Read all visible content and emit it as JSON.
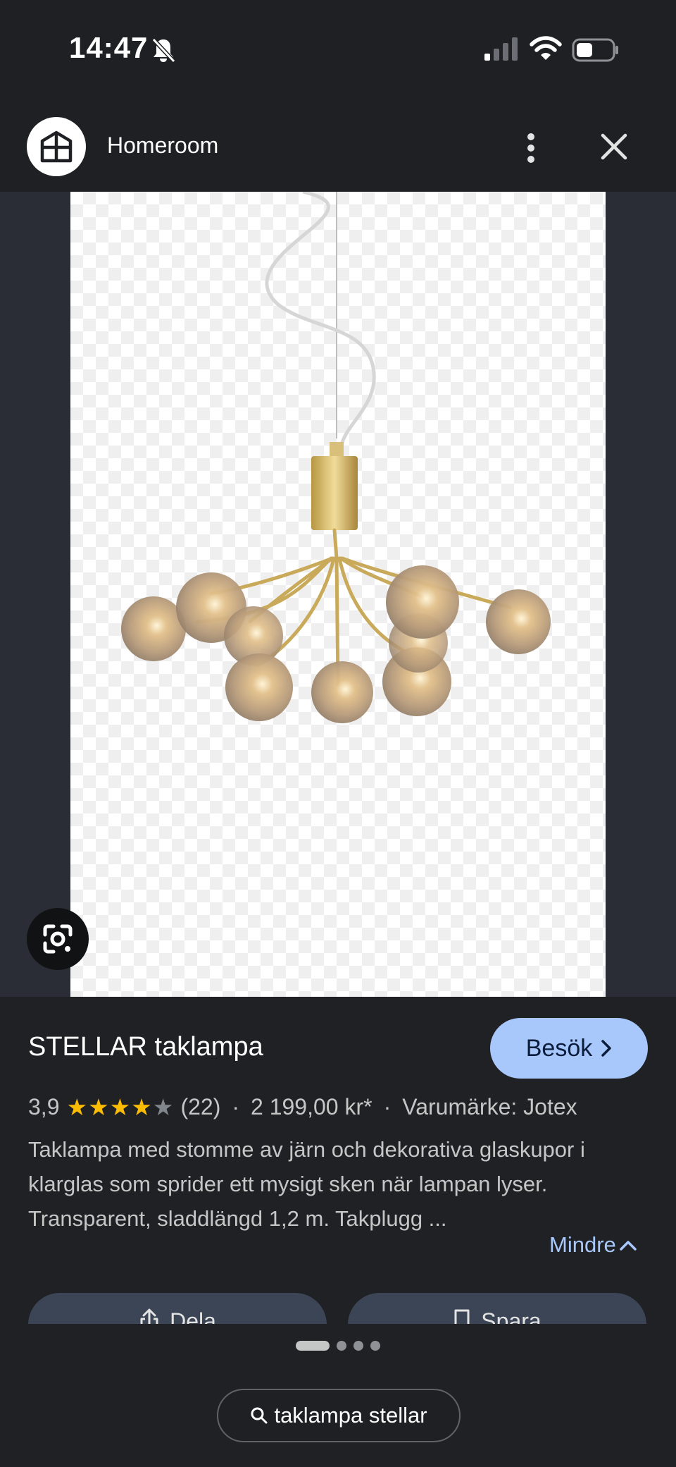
{
  "status_bar": {
    "time": "14:47",
    "icons": [
      "bell-slash-icon",
      "signal-icon",
      "wifi-icon",
      "battery-icon"
    ]
  },
  "header": {
    "site_name": "Homeroom",
    "logo_icon": "homeroom-logo-icon",
    "more_icon": "more-vert-icon",
    "close_icon": "close-icon"
  },
  "image": {
    "description_icon": "chandelier-image",
    "lens_icon": "google-lens-icon"
  },
  "product": {
    "title": "STELLAR taklampa",
    "visit_label": "Besök",
    "rating": "3,9",
    "rating_value": 3.9,
    "rating_max": 5,
    "reviews": "(22)",
    "separator": "·",
    "price": "2 199,00 kr*",
    "brand": "Varumärke: Jotex",
    "description": "Taklampa med stomme av järn och dekorativa glaskupor i klarglas som sprider ett mysigt sken när lampan lyser. Transparent, sladdlängd 1,2 m. Takplugg ...",
    "less_label": "Mindre",
    "share_label": "Dela",
    "save_label": "Spara"
  },
  "pagination": {
    "total": 4,
    "active": 1
  },
  "search_chip": {
    "label": "taklampa stellar"
  },
  "colors": {
    "background": "#202124",
    "accent": "#a8c7fa",
    "star": "#fbbc04",
    "button_dark": "#3c4556"
  }
}
